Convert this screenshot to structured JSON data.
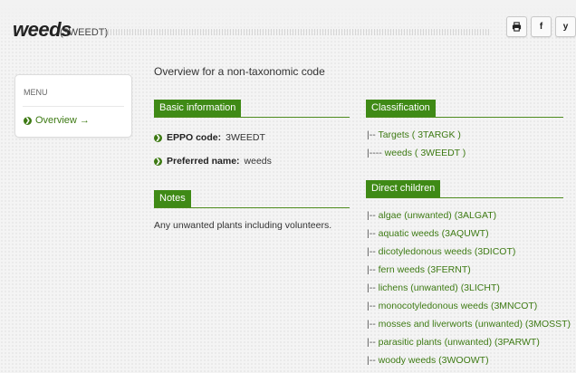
{
  "header": {
    "title": "weeds",
    "code": "(3WEEDT)",
    "share": {
      "print_glyph": "🖶",
      "facebook_glyph": "f",
      "twitter_glyph": "y"
    }
  },
  "sidebar": {
    "menu_label": "MENU",
    "items": [
      {
        "label": "Overview →",
        "bullet": "❯"
      }
    ]
  },
  "main": {
    "overview_title": "Overview for a non-taxonomic code",
    "basic_info": {
      "heading": "Basic information",
      "eppo_key": "EPPO code:",
      "eppo_value": "3WEEDT",
      "pref_key": "Preferred name:",
      "pref_value": "weeds"
    },
    "notes": {
      "heading": "Notes",
      "text": "Any unwanted plants including volunteers."
    },
    "classification": {
      "heading": "Classification",
      "items": [
        {
          "prefix": "|-- ",
          "label": "Targets ( 3TARGK )"
        },
        {
          "prefix": "|---- ",
          "label": "weeds ( 3WEEDT )"
        }
      ]
    },
    "direct_children": {
      "heading": "Direct children",
      "items": [
        {
          "prefix": "|-- ",
          "label": "algae (unwanted) (3ALGAT)"
        },
        {
          "prefix": "|-- ",
          "label": "aquatic weeds (3AQUWT)"
        },
        {
          "prefix": "|-- ",
          "label": "dicotyledonous weeds (3DICOT)"
        },
        {
          "prefix": "|-- ",
          "label": "fern weeds (3FERNT)"
        },
        {
          "prefix": "|-- ",
          "label": "lichens (unwanted) (3LICHT)"
        },
        {
          "prefix": "|-- ",
          "label": "monocotyledonous weeds (3MNCOT)"
        },
        {
          "prefix": "|-- ",
          "label": "mosses and liverworts (unwanted) (3MOSST)"
        },
        {
          "prefix": "|-- ",
          "label": "parasitic plants (unwanted) (3PARWT)"
        },
        {
          "prefix": "|-- ",
          "label": "woody weeds (3WOOWT)"
        }
      ]
    }
  }
}
